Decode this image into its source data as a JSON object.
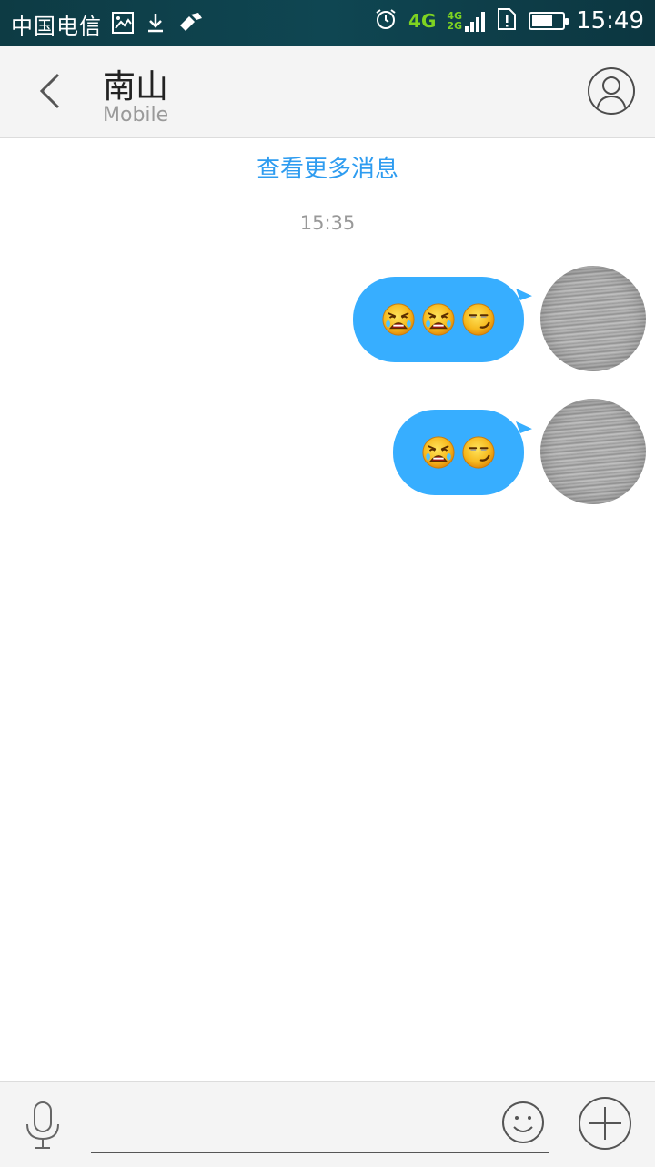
{
  "status_bar": {
    "carrier": "中国电信",
    "network_primary": "4G",
    "network_secondary_top": "4G",
    "network_secondary_bottom": "2G",
    "battery_level": 0.7,
    "time": "15:49",
    "icons": [
      "image-icon",
      "download-icon",
      "tool-icon",
      "alarm-icon",
      "sim-alert-icon",
      "battery-icon"
    ]
  },
  "header": {
    "title": "南山",
    "subtitle": "Mobile",
    "back_icon": "chevron-left-icon",
    "profile_icon": "person-icon"
  },
  "chat": {
    "load_more": "查看更多消息",
    "timestamp": "15:35",
    "messages": [
      {
        "sender": "me",
        "emojis": [
          "crying-angry-emoji",
          "crying-angry-emoji",
          "smirk-emoji"
        ]
      },
      {
        "sender": "me",
        "emojis": [
          "crying-angry-emoji",
          "smirk-emoji"
        ]
      }
    ]
  },
  "input_bar": {
    "text_value": "",
    "mic_icon": "microphone-icon",
    "emoji_icon": "smiley-icon",
    "plus_icon": "plus-icon"
  },
  "colors": {
    "accent": "#2e9cf0",
    "bubble": "#37aeff",
    "status_bar": "#0f4652",
    "network_green": "#7ed321"
  }
}
